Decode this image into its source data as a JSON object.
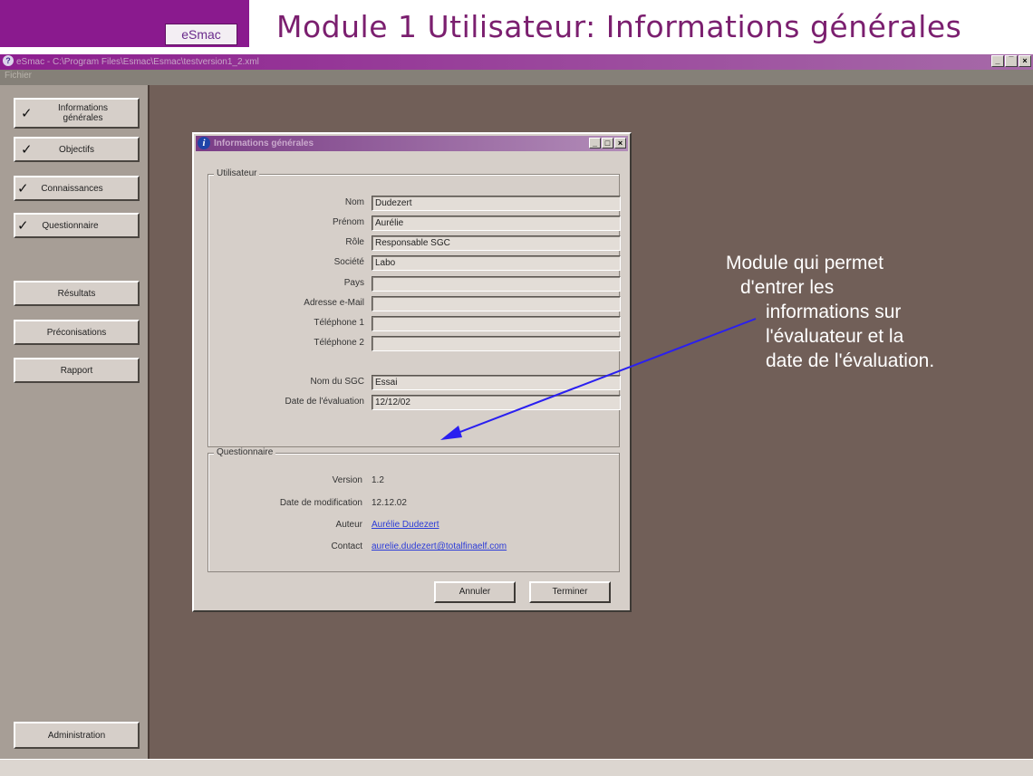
{
  "slide": {
    "logo_text": "eSmac",
    "title": "Module 1 Utilisateur: Informations générales"
  },
  "window": {
    "title": "eSmac - C:\\Program Files\\Esmac\\Esmac\\testversion1_2.xml",
    "controls": [
      "_",
      "̅",
      "×"
    ],
    "menu": {
      "fichier": "Fichier"
    }
  },
  "sidebar": {
    "items": [
      {
        "label": "Informations générales",
        "checked": true,
        "check": "✓"
      },
      {
        "label": "Objectifs",
        "checked": true,
        "check": "✓"
      },
      {
        "label": "Connaissances",
        "checked": true,
        "check": "✓"
      },
      {
        "label": "Questionnaire",
        "checked": true,
        "check": "✓"
      },
      {
        "label": "Résultats",
        "checked": false
      },
      {
        "label": "Préconisations",
        "checked": false
      },
      {
        "label": "Rapport",
        "checked": false
      }
    ],
    "admin": "Administration"
  },
  "dialog": {
    "title": "Informations générales",
    "utilisateur": {
      "legend": "Utilisateur",
      "fields": [
        {
          "label": "Nom",
          "value": "Dudezert"
        },
        {
          "label": "Prénom",
          "value": "Aurélie"
        },
        {
          "label": "Rôle",
          "value": "Responsable SGC"
        },
        {
          "label": "Société",
          "value": "Labo"
        },
        {
          "label": "Pays",
          "value": ""
        },
        {
          "label": "Adresse e-Mail",
          "value": ""
        },
        {
          "label": "Téléphone 1",
          "value": ""
        },
        {
          "label": "Téléphone 2",
          "value": ""
        },
        {
          "label": "Nom du SGC",
          "value": "Essai"
        },
        {
          "label": "Date de l'évaluation",
          "value": "12/12/02"
        }
      ]
    },
    "questionnaire": {
      "legend": "Questionnaire",
      "version_label": "Version",
      "version": "1.2",
      "date_label": "Date de modification",
      "date": "12.12.02",
      "auteur_label": "Auteur",
      "auteur": "Aurélie Dudezert",
      "contact_label": "Contact",
      "contact": "aurelie.dudezert@totalfinaelf.com"
    },
    "buttons": {
      "cancel": "Annuler",
      "finish": "Terminer"
    }
  },
  "annotation": {
    "lines": [
      "Module qui permet",
      "d'entrer les",
      "informations sur",
      "l'évaluateur et la",
      "date de l'évaluation."
    ],
    "arrow_color": "#2a1ff0"
  },
  "colors": {
    "banner": "#8a1a8e",
    "title_text": "#7b1f6f",
    "workspace": "#715f58",
    "sidebar": "#a79e96",
    "dialog": "#d6cfc9",
    "link": "#2b3bd8"
  }
}
